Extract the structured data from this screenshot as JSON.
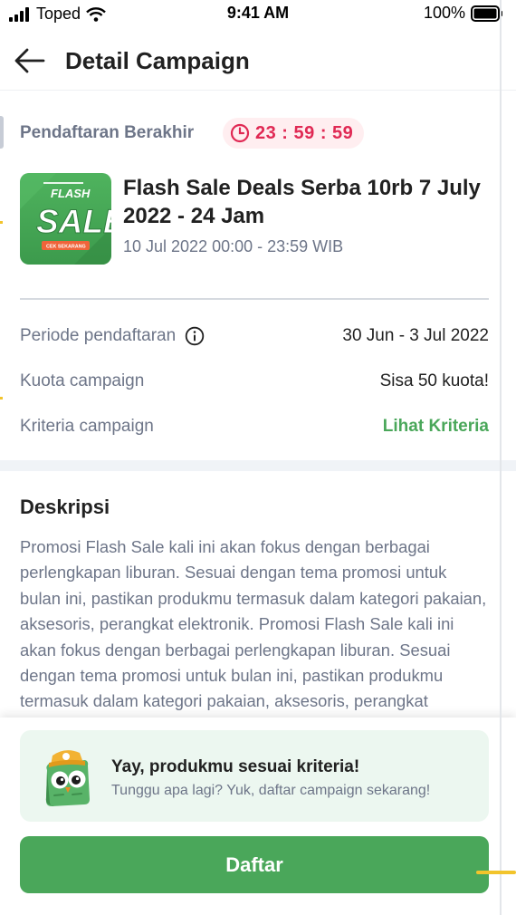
{
  "status_bar": {
    "carrier": "Toped",
    "time": "9:41 AM",
    "battery": "100%",
    "icons": [
      "signal-icon",
      "wifi-icon",
      "battery-icon"
    ]
  },
  "header": {
    "title": "Detail Campaign",
    "back_icon": "arrow-left-icon"
  },
  "campaign": {
    "registration_label": "Pendaftaran Berakhir",
    "countdown": "23 : 59 : 59",
    "thumbnail": {
      "brand_top": "FLASH",
      "brand_main": "SALE",
      "cta": "CEK SEKARANG"
    },
    "title": "Flash Sale Deals Serba 10rb 7 July 2022 - 24 Jam",
    "date": "10 Jul 2022 00:00 - 23:59 WIB"
  },
  "details": {
    "period": {
      "label": "Periode pendaftaran",
      "value": "30 Jun - 3 Jul 2022"
    },
    "quota": {
      "label": "Kuota campaign",
      "value": "Sisa 50 kuota!"
    },
    "criteria": {
      "label": "Kriteria campaign",
      "link": "Lihat Kriteria"
    }
  },
  "description": {
    "title": "Deskripsi",
    "text": "Promosi Flash Sale kali ini akan fokus dengan berbagai perlengkapan liburan. Sesuai dengan tema promosi untuk bulan ini, pastikan produkmu termasuk dalam kategori pakaian, aksesoris, perangkat elektronik. Promosi Flash Sale kali ini akan fokus dengan berbagai perlengkapan liburan. Sesuai dengan tema promosi untuk bulan ini, pastikan produkmu termasuk dalam kategori pakaian, aksesoris, perangkat elektronik."
  },
  "footer": {
    "eligible_title": "Yay, produkmu sesuai kriteria!",
    "eligible_subtitle": "Tunggu apa lagi? Yuk, daftar campaign sekarang!",
    "register_button": "Daftar"
  },
  "colors": {
    "primary_green": "#4aa75a",
    "timer_red": "#e02954",
    "muted_text": "#6d7588"
  }
}
